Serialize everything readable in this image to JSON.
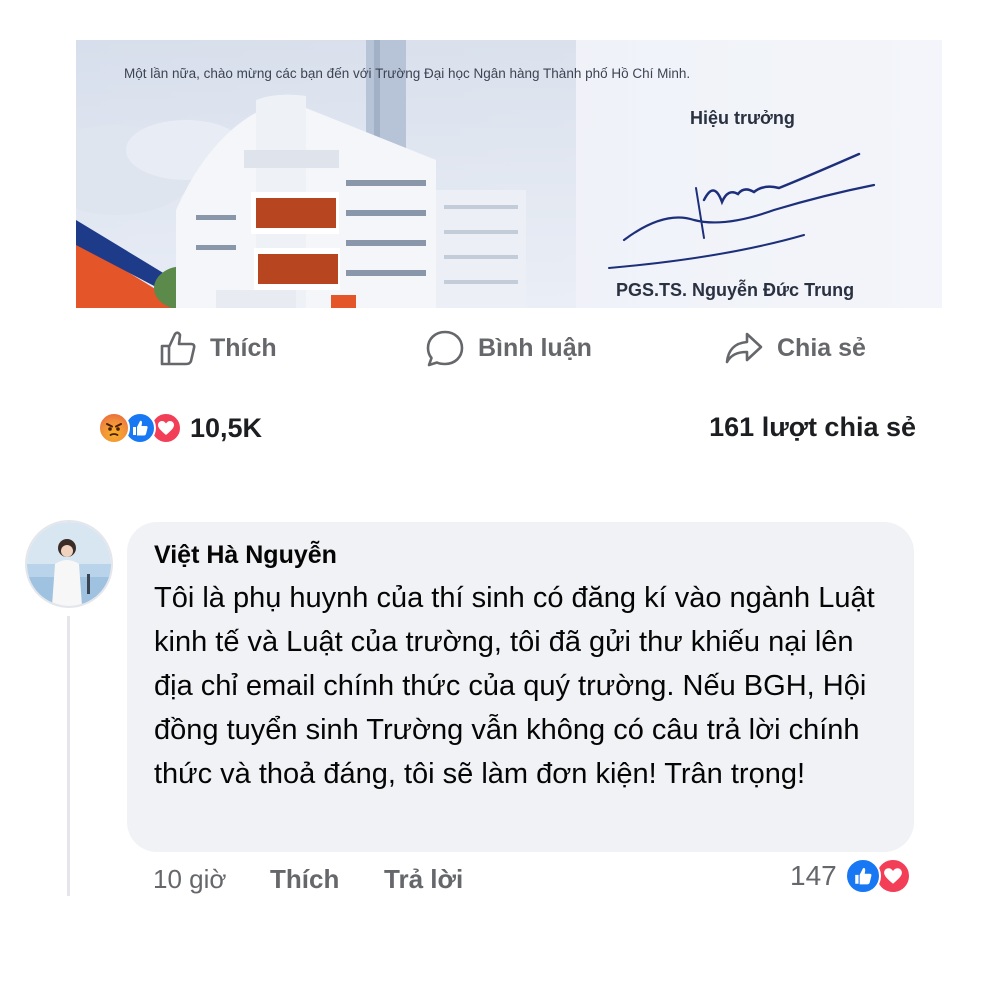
{
  "post_image": {
    "welcome_text": "Một lần nữa, chào mừng các bạn đến với Trường Đại học Ngân hàng Thành phố Hồ Chí Minh.",
    "signer_title": "Hiệu trưởng",
    "signer_name": "PGS.TS. Nguyễn Đức Trung"
  },
  "actions": {
    "like_label": "Thích",
    "comment_label": "Bình luận",
    "share_label": "Chia sẻ"
  },
  "stats": {
    "reaction_icons": [
      "angry-icon",
      "like-icon",
      "love-icon"
    ],
    "reaction_count": "10,5K",
    "share_count": "161 lượt chia sẻ"
  },
  "comment": {
    "author": "Việt Hà Nguyễn",
    "text": "Tôi là phụ huynh của thí sinh có đăng kí vào ngành Luật kinh tế và Luật của trường, tôi đã gửi thư khiếu nại lên địa chỉ email chính thức của quý trường. Nếu BGH, Hội đồng tuyển sinh Trường vẫn không có câu trả lời chính thức và thoả đáng, tôi sẽ làm đơn kiện! Trân trọng!",
    "time": "10 giờ",
    "like_label": "Thích",
    "reply_label": "Trả lời",
    "reaction_count": "147",
    "reaction_icons": [
      "like-icon",
      "love-icon"
    ]
  },
  "colors": {
    "like_blue": "#1877f2",
    "love_red": "#f33e58",
    "muted_text": "#65676b",
    "bubble_bg": "#f0f2f5"
  }
}
